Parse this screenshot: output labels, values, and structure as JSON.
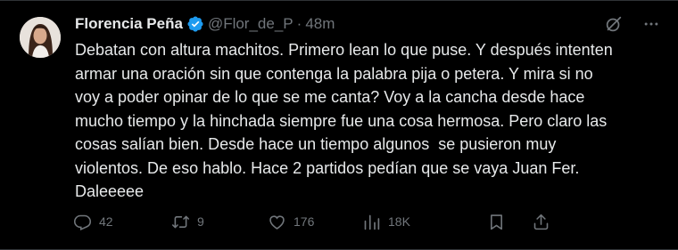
{
  "author": {
    "name": "Florencia Peña",
    "handle": "@Flor_de_P",
    "separator": "·",
    "time": "48m"
  },
  "tweet_text": "Debatan con altura machitos. Primero lean lo que puse. Y después intenten\narmar una oración sin que contenga la palabra pija o petera. Y mira si no\nvoy a poder opinar de lo que se me canta? Voy a la cancha desde hace\nmucho tiempo y la hinchada siempre fue una cosa hermosa. Pero claro las\ncosas salían bien. Desde hace un tiempo algunos  se pusieron muy\nviolentos. De eso hablo. Hace 2 partidos pedían que se vaya Juan Fer.\nDaleeeee",
  "stats": {
    "replies": "42",
    "retweets": "9",
    "likes": "176",
    "views": "18K"
  },
  "colors": {
    "background": "#000000",
    "text": "#e7e9ea",
    "muted": "#71767b",
    "verified": "#1d9bf0"
  },
  "icons": [
    "verified-badge-icon",
    "grok-icon",
    "more-icon",
    "reply-icon",
    "retweet-icon",
    "like-icon",
    "views-icon",
    "bookmark-icon",
    "share-icon"
  ]
}
